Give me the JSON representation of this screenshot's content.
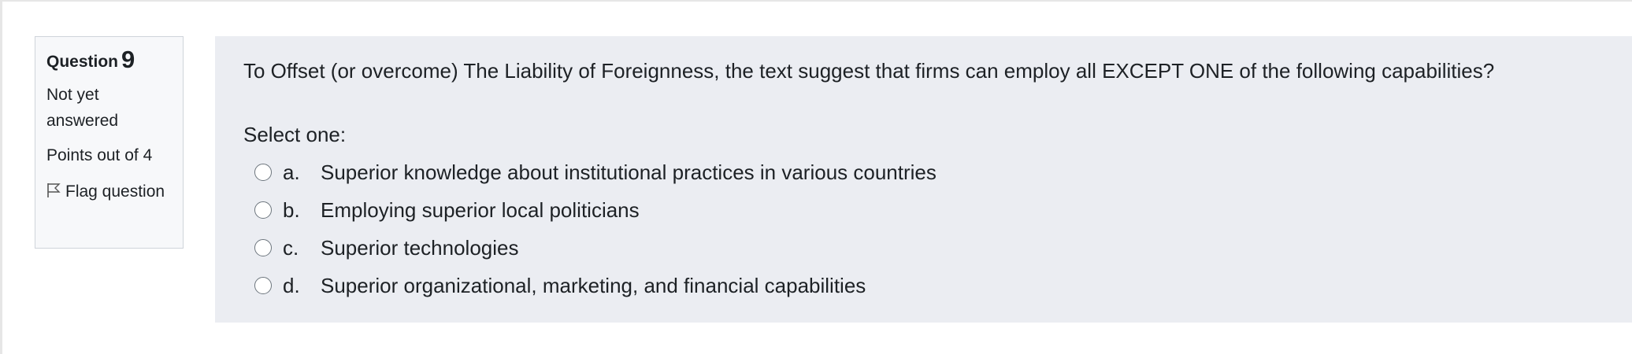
{
  "info": {
    "question_word": "Question",
    "question_number": "9",
    "state": "Not yet answered",
    "grade": "Points out of 4",
    "flag_label": "Flag question"
  },
  "question": {
    "text": "To Offset (or overcome) The Liability of Foreignness, the text suggest that firms can employ all EXCEPT ONE of the following capabilities?",
    "prompt": "Select one:",
    "answers": [
      {
        "letter": "a.",
        "label": "Superior knowledge about institutional practices in various countries"
      },
      {
        "letter": "b.",
        "label": "Employing superior local politicians"
      },
      {
        "letter": "c.",
        "label": "Superior technologies"
      },
      {
        "letter": "d.",
        "label": "Superior organizational, marketing, and financial capabilities"
      }
    ]
  },
  "icons": {
    "flag": "flag-icon",
    "radio": "radio-button"
  },
  "colors": {
    "info_background": "#f7f8fa",
    "content_background": "#ebedf2",
    "text": "#1d2125"
  }
}
